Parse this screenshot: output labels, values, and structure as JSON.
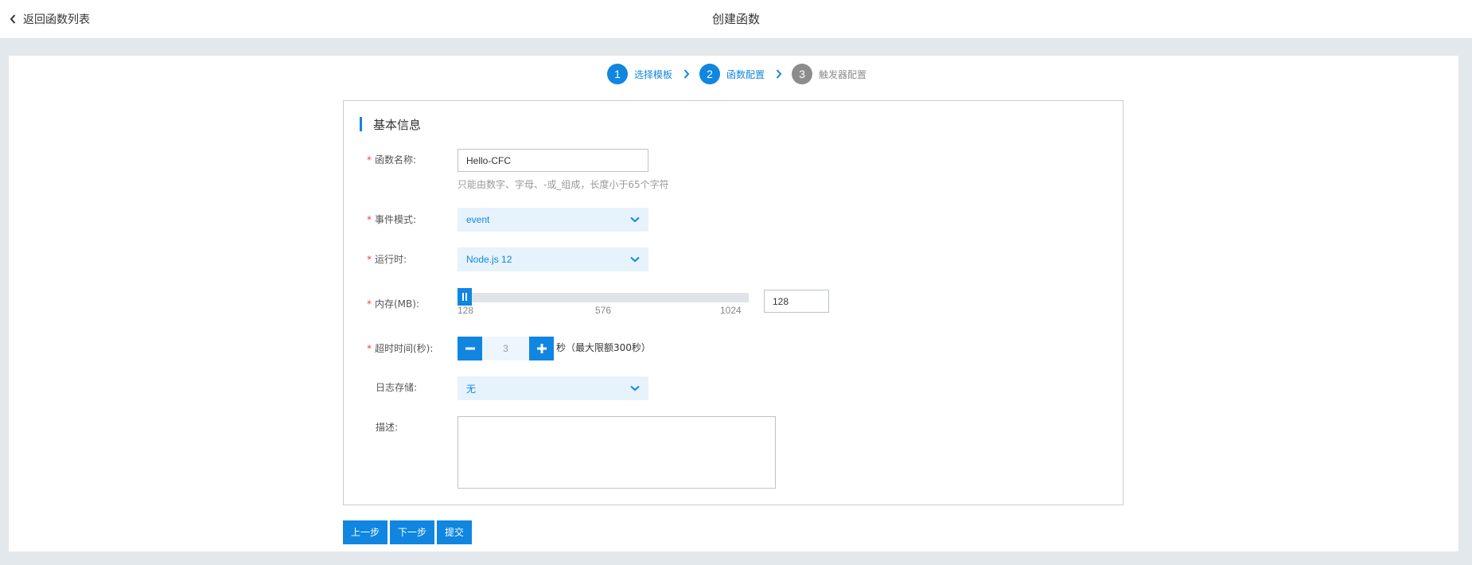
{
  "header": {
    "back_label": "返回函数列表",
    "title": "创建函数"
  },
  "steps": [
    {
      "number": "1",
      "label": "选择模板",
      "state": "done"
    },
    {
      "number": "2",
      "label": "函数配置",
      "state": "active"
    },
    {
      "number": "3",
      "label": "触发器配置",
      "state": "pending"
    }
  ],
  "form": {
    "section_title": "基本信息",
    "name": {
      "label": "函数名称:",
      "value": "Hello-CFC",
      "hint": "只能由数字、字母、-或_组成，长度小于65个字符"
    },
    "event_mode": {
      "label": "事件模式:",
      "value": "event"
    },
    "runtime": {
      "label": "运行时:",
      "value": "Node.js 12"
    },
    "memory": {
      "label": "内存(MB):",
      "value": "128",
      "min_label": "128",
      "mid_label": "576",
      "max_label": "1024",
      "level_fraction": 0
    },
    "timeout": {
      "label": "超时时间(秒):",
      "value": "3",
      "suffix": "秒（最大限额300秒）"
    },
    "log_storage": {
      "label": "日志存储:",
      "value": "无"
    },
    "description": {
      "label": "描述:",
      "value": ""
    }
  },
  "buttons": {
    "prev": "上一步",
    "next": "下一步",
    "submit": "提交"
  },
  "colors": {
    "accent": "#1086e0",
    "required": "#e64b3b",
    "inactive_step": "#8c8c8c"
  }
}
